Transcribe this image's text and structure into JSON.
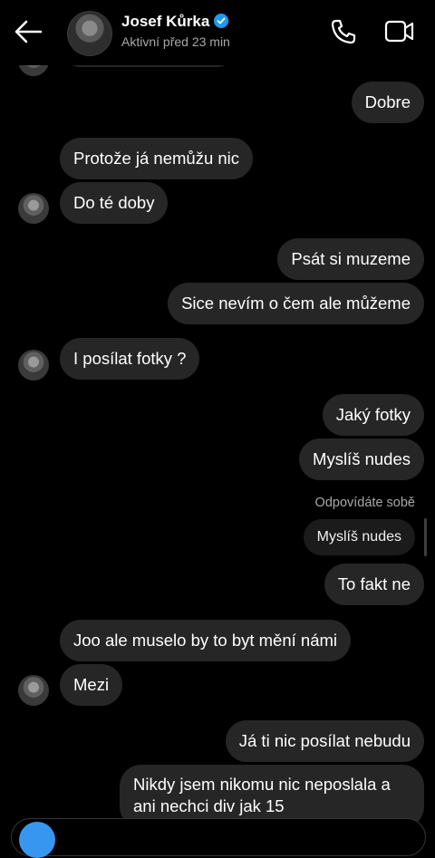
{
  "header": {
    "contact_name": "Josef Kůrka",
    "status": "Aktivní před 23 min",
    "verified": true,
    "accent_color": "#1d9bf0"
  },
  "messages": [
    {
      "dir": "out",
      "text": "Dobre"
    },
    {
      "dir": "in",
      "text": "Protože já nemůžu nic"
    },
    {
      "dir": "in",
      "text": "Do té doby"
    },
    {
      "dir": "out",
      "text": "Psát si muzeme"
    },
    {
      "dir": "out",
      "text": "Sice nevím o čem ale můžeme"
    },
    {
      "dir": "in",
      "text": "I posílat fotky ?"
    },
    {
      "dir": "out",
      "text": "Jaký fotky"
    },
    {
      "dir": "out",
      "text": "Myslíš nudes"
    },
    {
      "dir": "out",
      "text": "To fakt ne"
    },
    {
      "dir": "in",
      "text": "Joo ale muselo by to byt mění námi"
    },
    {
      "dir": "in",
      "text": "Mezi"
    },
    {
      "dir": "out",
      "text": "Já ti nic posílat nebudu"
    },
    {
      "dir": "out",
      "text": "Nikdy jsem nikomu nic neposlala a ani nechci div jak 15"
    }
  ],
  "reply": {
    "label": "Odpovídáte sobě",
    "quoted_text": "Myslíš nudes"
  },
  "icons": {
    "back": "arrow-left-icon",
    "call": "phone-icon",
    "video": "video-camera-icon",
    "camera": "camera-icon"
  },
  "colors": {
    "background": "#000000",
    "bubble": "#262626",
    "camera_button": "#3797f0"
  }
}
